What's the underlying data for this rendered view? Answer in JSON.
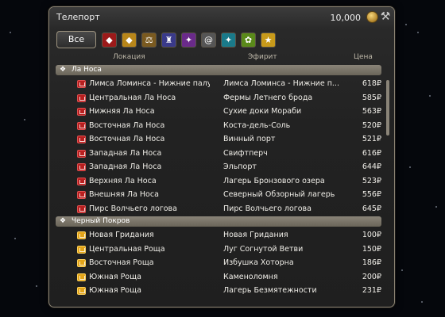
{
  "window": {
    "title": "Телепорт",
    "gil": "10,000"
  },
  "filters": {
    "all_label": "Все",
    "icons": [
      {
        "name": "red-mask-filter-icon",
        "color": "#9c1a1a",
        "glyph": "◆"
      },
      {
        "name": "yellow-lion-filter-icon",
        "color": "#b8861a",
        "glyph": "◆"
      },
      {
        "name": "scales-filter-icon",
        "color": "#7a5a20",
        "glyph": "⚖"
      },
      {
        "name": "castle-filter-icon",
        "color": "#3a3a8a",
        "glyph": "♜"
      },
      {
        "name": "purple-crest-filter-icon",
        "color": "#6a2a8a",
        "glyph": "✦"
      },
      {
        "name": "swirl-filter-icon",
        "color": "#555555",
        "glyph": "@"
      },
      {
        "name": "teal-crest-filter-icon",
        "color": "#1a7a8a",
        "glyph": "✦"
      },
      {
        "name": "green-crest-filter-icon",
        "color": "#5a8a1a",
        "glyph": "✿"
      },
      {
        "name": "star-filter-icon",
        "color": "#c89a1a",
        "glyph": "★"
      }
    ]
  },
  "columns": {
    "location": "Локация",
    "aetheryte": "Эфирит",
    "price": "Цена"
  },
  "groups": [
    {
      "name": "Ла Носа",
      "icon_color": "red",
      "rows": [
        {
          "location": "Лимса Ломинса - Нижние палу...",
          "aetheryte": "Лимса Ломинса - Нижние п...",
          "price": "618₽"
        },
        {
          "location": "Центральная Ла Носа",
          "aetheryte": "Фермы Летнего брода",
          "price": "585₽"
        },
        {
          "location": "Нижняя Ла Носа",
          "aetheryte": "Сухие доки Мораби",
          "price": "563₽"
        },
        {
          "location": "Восточная Ла Носа",
          "aetheryte": "Коста-дель-Соль",
          "price": "520₽"
        },
        {
          "location": "Восточная Ла Носа",
          "aetheryte": "Винный порт",
          "price": "521₽"
        },
        {
          "location": "Западная Ла Носа",
          "aetheryte": "Свифтперч",
          "price": "616₽"
        },
        {
          "location": "Западная Ла Носа",
          "aetheryte": "Эльпорт",
          "price": "644₽"
        },
        {
          "location": "Верхняя Ла Носа",
          "aetheryte": "Лагерь Бронзового озера",
          "price": "523₽"
        },
        {
          "location": "Внешняя Ла Носа",
          "aetheryte": "Северный Обзорный лагерь",
          "price": "556₽"
        },
        {
          "location": "Пирс Волчьего логова",
          "aetheryte": "Пирс Волчьего логова",
          "price": "645₽"
        }
      ]
    },
    {
      "name": "Черный Покров",
      "icon_color": "yellow",
      "rows": [
        {
          "location": "Новая Гридания",
          "aetheryte": "Новая Гридания",
          "price": "100₽"
        },
        {
          "location": "Центральная Роща",
          "aetheryte": "Луг Согнутой Ветви",
          "price": "150₽"
        },
        {
          "location": "Восточная Роща",
          "aetheryte": "Избушка Хоторна",
          "price": "186₽"
        },
        {
          "location": "Южная Роща",
          "aetheryte": "Каменоломня",
          "price": "200₽"
        },
        {
          "location": "Южная Роща",
          "aetheryte": "Лагерь Безмятежности",
          "price": "231₽"
        }
      ]
    }
  ]
}
